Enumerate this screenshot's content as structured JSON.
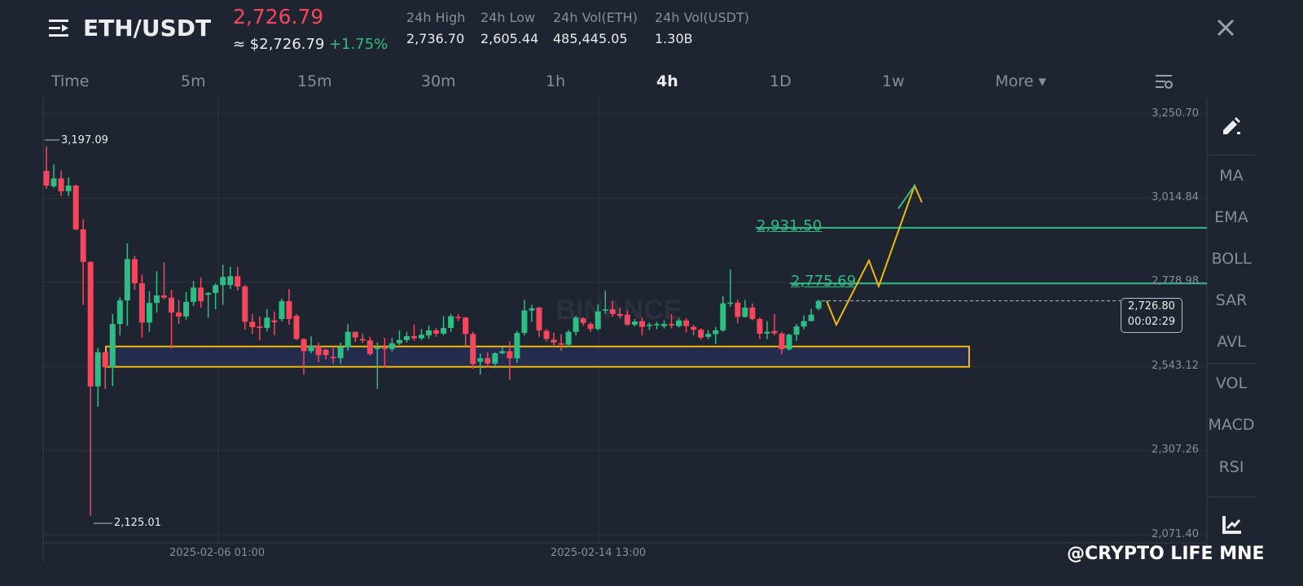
{
  "header": {
    "pair": "ETH/USDT",
    "last_price": "2,726.79",
    "approx_usd": "≈ $2,726.79",
    "change_pct": "+1.75%",
    "stats": [
      {
        "label": "24h High",
        "value": "2,736.70"
      },
      {
        "label": "24h Low",
        "value": "2,605.44"
      },
      {
        "label": "24h Vol(ETH)",
        "value": "485,445.05"
      },
      {
        "label": "24h Vol(USDT)",
        "value": "1.30B"
      }
    ],
    "close_icon": "close-icon",
    "menu_icon": "menu-icon"
  },
  "intervals": {
    "items": [
      "Time",
      "5m",
      "15m",
      "30m",
      "1h",
      "4h",
      "1D",
      "1w",
      "More ▾"
    ],
    "active": "4h",
    "settings_icon": "chart-settings-icon"
  },
  "sidebar": {
    "indicators_top": [
      "MA",
      "EMA",
      "BOLL",
      "SAR",
      "AVL"
    ],
    "indicators_bottom": [
      "VOL",
      "MACD",
      "RSI"
    ],
    "draw_icon": "pencil-icon",
    "chart_icon": "trend-chart-icon"
  },
  "colors": {
    "up": "#2ebd85",
    "down": "#f6465d",
    "accent": "#f0b90b",
    "zone_fill": "#252e4f"
  },
  "watermark": "BINANCE",
  "footer_watermark": "@CRYPTO LIFE MNE",
  "chart_data": {
    "type": "candlestick",
    "y_ticks": [
      "3,250.70",
      "3,014.84",
      "2,778.98",
      "2,543.12",
      "2,307.26",
      "2,071.40"
    ],
    "y_tick_values": [
      3250.7,
      3014.84,
      2778.98,
      2543.12,
      2307.26,
      2071.4
    ],
    "x_ticks": [
      "2025-02-06 01:00",
      "2025-02-14 13:00"
    ],
    "period_high_label": "3,197.09",
    "period_low_label": "2,125.01",
    "current_price_tag": "2,726.80",
    "countdown": "00:02:29",
    "levels": [
      {
        "label": "2,931.50",
        "value": 2931.5
      },
      {
        "label": "2,775.69",
        "value": 2775.69
      }
    ],
    "support_zone": [
      2542,
      2599
    ],
    "projection_path": [
      2726.8,
      2660,
      2840,
      2768,
      3050,
      3003
    ],
    "candles": [
      [
        3091,
        3160,
        3041,
        3050
      ],
      [
        3048,
        3109,
        3044,
        3070
      ],
      [
        3070,
        3093,
        3020,
        3034
      ],
      [
        3034,
        3073,
        3020,
        3050
      ],
      [
        3050,
        3052,
        2925,
        2927
      ],
      [
        2927,
        2955,
        2715,
        2836
      ],
      [
        2836,
        2838,
        2125.01,
        2487
      ],
      [
        2487,
        2595,
        2430,
        2583
      ],
      [
        2583,
        2585,
        2480,
        2541
      ],
      [
        2541,
        2690,
        2488,
        2662
      ],
      [
        2662,
        2737,
        2630,
        2728
      ],
      [
        2728,
        2888,
        2657,
        2844
      ],
      [
        2844,
        2853,
        2758,
        2776
      ],
      [
        2776,
        2800,
        2623,
        2666
      ],
      [
        2666,
        2753,
        2640,
        2721
      ],
      [
        2721,
        2810,
        2694,
        2742
      ],
      [
        2742,
        2835,
        2731,
        2736
      ],
      [
        2736,
        2758,
        2593,
        2694
      ],
      [
        2694,
        2730,
        2662,
        2683
      ],
      [
        2683,
        2751,
        2674,
        2724
      ],
      [
        2724,
        2783,
        2712,
        2764
      ],
      [
        2764,
        2792,
        2708,
        2726
      ],
      [
        2744,
        2751,
        2680,
        2749
      ],
      [
        2749,
        2776,
        2703,
        2771
      ],
      [
        2771,
        2828,
        2715,
        2794
      ],
      [
        2771,
        2822,
        2760,
        2796
      ],
      [
        2796,
        2822,
        2756,
        2767
      ],
      [
        2767,
        2772,
        2646,
        2668
      ],
      [
        2668,
        2690,
        2634,
        2653
      ],
      [
        2655,
        2683,
        2616,
        2651
      ],
      [
        2651,
        2703,
        2641,
        2680
      ],
      [
        2672,
        2697,
        2630,
        2667
      ],
      [
        2676,
        2733,
        2669,
        2726
      ],
      [
        2726,
        2760,
        2660,
        2676
      ],
      [
        2685,
        2690,
        2617,
        2620
      ],
      [
        2620,
        2622,
        2520,
        2586
      ],
      [
        2586,
        2628,
        2580,
        2601
      ],
      [
        2600,
        2610,
        2555,
        2575
      ],
      [
        2590,
        2593,
        2562,
        2575
      ],
      [
        2570,
        2595,
        2550,
        2566
      ],
      [
        2566,
        2610,
        2550,
        2597
      ],
      [
        2597,
        2662,
        2587,
        2640
      ],
      [
        2640,
        2641,
        2612,
        2624
      ],
      [
        2620,
        2635,
        2609,
        2616
      ],
      [
        2616,
        2626,
        2573,
        2578
      ],
      [
        2592,
        2610,
        2480,
        2596
      ],
      [
        2596,
        2623,
        2540,
        2592
      ],
      [
        2592,
        2623,
        2585,
        2608
      ],
      [
        2608,
        2644,
        2603,
        2617
      ],
      [
        2617,
        2640,
        2610,
        2628
      ],
      [
        2628,
        2660,
        2615,
        2622
      ],
      [
        2622,
        2648,
        2617,
        2632
      ],
      [
        2630,
        2657,
        2620,
        2644
      ],
      [
        2644,
        2651,
        2626,
        2635
      ],
      [
        2635,
        2684,
        2630,
        2651
      ],
      [
        2651,
        2690,
        2640,
        2684
      ],
      [
        2682,
        2690,
        2670,
        2680
      ],
      [
        2680,
        2682,
        2600,
        2634
      ],
      [
        2634,
        2640,
        2537,
        2550
      ],
      [
        2556,
        2579,
        2520,
        2566
      ],
      [
        2566,
        2583,
        2540,
        2551
      ],
      [
        2551,
        2583,
        2538,
        2580
      ],
      [
        2580,
        2597,
        2577,
        2586
      ],
      [
        2586,
        2613,
        2505,
        2566
      ],
      [
        2566,
        2643,
        2553,
        2637
      ],
      [
        2637,
        2730,
        2630,
        2700
      ],
      [
        2700,
        2716,
        2668,
        2706
      ],
      [
        2708,
        2710,
        2626,
        2644
      ],
      [
        2643,
        2648,
        2613,
        2620
      ],
      [
        2618,
        2638,
        2598,
        2610
      ],
      [
        2608,
        2633,
        2587,
        2604
      ],
      [
        2604,
        2645,
        2598,
        2640
      ],
      [
        2640,
        2685,
        2630,
        2680
      ],
      [
        2678,
        2681,
        2657,
        2665
      ],
      [
        2662,
        2667,
        2640,
        2648
      ],
      [
        2648,
        2717,
        2644,
        2697
      ],
      [
        2700,
        2755,
        2690,
        2703
      ],
      [
        2703,
        2726,
        2682,
        2690
      ],
      [
        2690,
        2708,
        2678,
        2685
      ],
      [
        2688,
        2700,
        2657,
        2660
      ],
      [
        2660,
        2676,
        2655,
        2669
      ],
      [
        2670,
        2680,
        2630,
        2654
      ],
      [
        2657,
        2666,
        2645,
        2660
      ],
      [
        2660,
        2668,
        2647,
        2662
      ],
      [
        2656,
        2672,
        2650,
        2662
      ],
      [
        2662,
        2690,
        2650,
        2658
      ],
      [
        2656,
        2678,
        2652,
        2672
      ],
      [
        2672,
        2678,
        2638,
        2656
      ],
      [
        2654,
        2660,
        2630,
        2646
      ],
      [
        2646,
        2650,
        2618,
        2624
      ],
      [
        2626,
        2645,
        2620,
        2634
      ],
      [
        2634,
        2654,
        2606,
        2644
      ],
      [
        2644,
        2740,
        2640,
        2720
      ],
      [
        2720,
        2815,
        2710,
        2722
      ],
      [
        2722,
        2730,
        2664,
        2682
      ],
      [
        2682,
        2730,
        2680,
        2708
      ],
      [
        2708,
        2720,
        2672,
        2676
      ],
      [
        2676,
        2680,
        2620,
        2635
      ],
      [
        2635,
        2670,
        2620,
        2640
      ],
      [
        2642,
        2690,
        2630,
        2636
      ],
      [
        2635,
        2640,
        2577,
        2591
      ],
      [
        2591,
        2635,
        2587,
        2632
      ],
      [
        2632,
        2662,
        2615,
        2655
      ],
      [
        2655,
        2686,
        2647,
        2670
      ],
      [
        2670,
        2705,
        2680,
        2688
      ],
      [
        2705,
        2730,
        2700,
        2726.8
      ]
    ]
  }
}
